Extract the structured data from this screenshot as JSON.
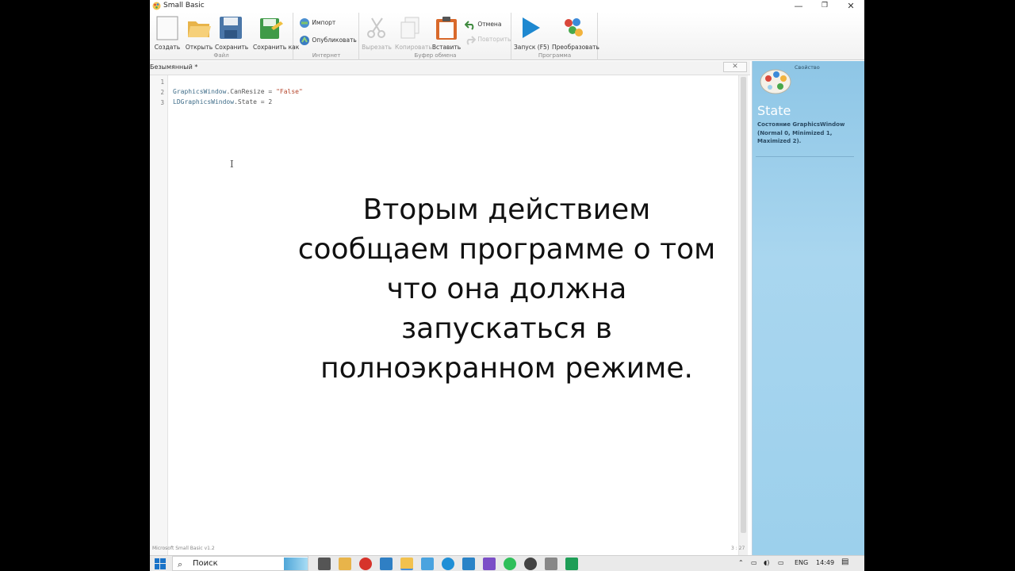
{
  "window": {
    "title": "Small Basic"
  },
  "ribbon": {
    "file_group": {
      "label": "Файл",
      "buttons": [
        "Создать",
        "Открыть",
        "Сохранить",
        "Сохранить как"
      ]
    },
    "internet_group": {
      "label": "Интернет",
      "buttons": [
        "Импорт",
        "Опубликовать"
      ]
    },
    "clipboard_group": {
      "label": "Буфер обмена",
      "buttons": [
        "Вырезать",
        "Копировать",
        "Вставить",
        "Отмена",
        "Повторить"
      ]
    },
    "program_group": {
      "label": "Программа",
      "buttons": [
        "Запуск (F5)",
        "Преобразовать"
      ]
    }
  },
  "editor": {
    "tab_title": "Безымянный *",
    "lines": [
      {
        "num": "1",
        "obj": "",
        "rest": "",
        "str": ""
      },
      {
        "num": "2",
        "obj": "GraphicsWindow",
        "rest": ".CanResize = ",
        "str": "\"False\""
      },
      {
        "num": "3",
        "obj": "LDGraphicsWindow",
        "rest": ".State = 2",
        "str": ""
      }
    ],
    "status_left": "Microsoft Small Basic v1.2",
    "status_right": "3 : 27"
  },
  "caption": {
    "lines": [
      "Вторым действием",
      "сообщаем программе о том",
      "что она должна",
      "запускаться в",
      "полноэкранном режиме."
    ]
  },
  "help_panel": {
    "kind": "Свойство",
    "name": "State",
    "description": "Состояние GraphicsWindow (Normal 0, Minimized 1, Maximized 2)."
  },
  "taskbar": {
    "search_placeholder": "Поиск",
    "language": "ENG",
    "time": "14:49"
  },
  "colors": {
    "help_panel_bg": "#a9d6ef",
    "code_object": "#3f6d89",
    "code_string": "#b5462c",
    "run_button": "#1e88d0"
  },
  "icons": [
    "app-icon",
    "new-file-icon",
    "open-folder-icon",
    "save-icon",
    "save-as-icon",
    "import-icon",
    "publish-icon",
    "cut-icon",
    "copy-icon",
    "paste-icon",
    "undo-icon",
    "redo-icon",
    "run-icon",
    "graduate-icon",
    "palette-icon",
    "windows-start-icon",
    "search-icon"
  ]
}
